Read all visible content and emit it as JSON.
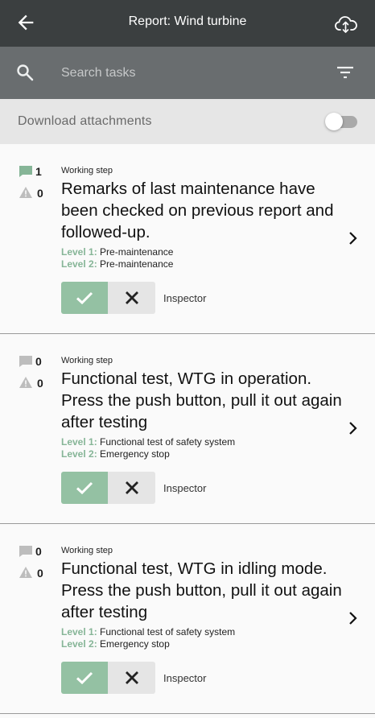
{
  "header": {
    "title": "Report: Wind turbine",
    "back_icon": "arrow-left-icon",
    "sync_icon": "cloud-sync-icon"
  },
  "search": {
    "placeholder": "Search tasks",
    "value": "",
    "search_icon": "search-icon",
    "filter_icon": "filter-icon"
  },
  "download": {
    "label": "Download attachments",
    "enabled": false
  },
  "colors": {
    "appbar": "#3b3f40",
    "searchbar": "#696d6f",
    "accent_green": "#94c1a3",
    "level_key": "#86b597",
    "comment_active": "#86b597",
    "comment_inactive": "#bdbdbd"
  },
  "tasks": [
    {
      "comments": "1",
      "comments_active": true,
      "warnings": "0",
      "kind": "Working step",
      "title": "Remarks of last maintenance have been checked on previous report and followed-up.",
      "level1_key": "Level 1:",
      "level1": "Pre-maintenance",
      "level2_key": "Level 2:",
      "level2": "Pre-maintenance",
      "role": "Inspector"
    },
    {
      "comments": "0",
      "comments_active": false,
      "warnings": "0",
      "kind": "Working step",
      "title": "Functional test, WTG in operation. Press the push button, pull it out again after testing",
      "level1_key": "Level 1:",
      "level1": "Functional test of safety system",
      "level2_key": "Level 2:",
      "level2": "Emergency stop",
      "role": "Inspector"
    },
    {
      "comments": "0",
      "comments_active": false,
      "warnings": "0",
      "kind": "Working step",
      "title": "Functional test, WTG in idling mode. Press the push button, pull it out again after testing",
      "level1_key": "Level 1:",
      "level1": "Functional test of safety system",
      "level2_key": "Level 2:",
      "level2": "Emergency stop",
      "role": "Inspector"
    }
  ]
}
